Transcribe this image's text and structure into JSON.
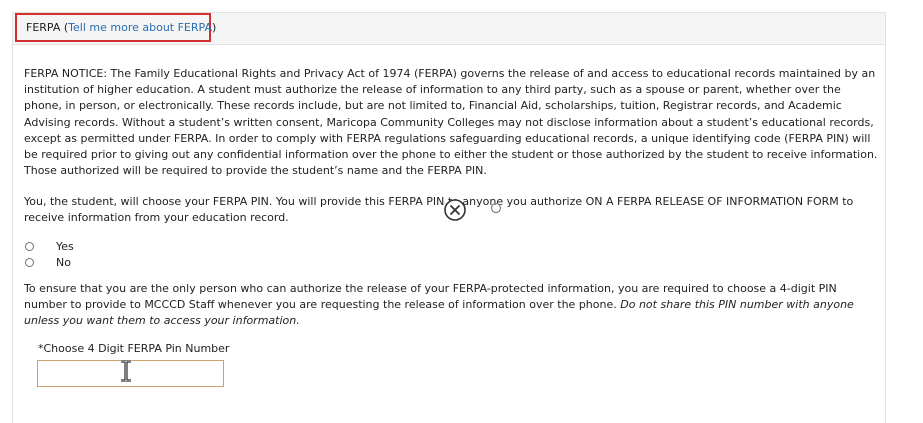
{
  "header": {
    "title_prefix": "FERPA (",
    "link": "Tell me more about FERPA",
    "title_suffix": ")"
  },
  "notice": "FERPA NOTICE: The Family Educational Rights and Privacy Act of 1974 (FERPA) governs the release of and access to educational records maintained by an institution of higher education. A student must authorize the release of information to any third party, such as a spouse or parent, whether over the phone, in person, or electronically. These records include, but are not limited to, Financial Aid, scholarships, tuition, Registrar records, and Academic Advising records. Without a student’s written consent, Maricopa Community Colleges may not disclose information about a student’s educational records, except as permitted under FERPA. In order to comply with FERPA regulations safeguarding educational records, a unique identifying code (FERPA PIN) will be required prior to giving out any confidential information over the phone to either the student or those authorized by the student to receive information. Those authorized will be required to provide the student’s name and the FERPA PIN.",
  "choose_text": "You, the student, will choose your FERPA PIN. You will provide this FERPA PIN to anyone you authorize ON A FERPA RELEASE OF INFORMATION FORM to receive information from your education record.",
  "radio_options": [
    "Yes",
    "No"
  ],
  "info_text": "To ensure that you are the only person who can authorize the release of your FERPA-protected information, you are required to choose a 4-digit PIN number to provide to MCCCD Staff whenever you are requesting the release of information over the phone.",
  "info_italic": "Do not share this PIN number with anyone unless you want them to access your information.",
  "pin": {
    "label": "*Choose 4 Digit FERPA Pin Number",
    "value": ""
  },
  "icons": {
    "overlay_close": "close-circle-icon",
    "overlay_small": "small-circle-icon",
    "text_cursor": "i-beam-cursor-icon"
  },
  "colors": {
    "link": "#2a6db0",
    "highlight_border": "#d32f2f",
    "input_border": "#c9a26e"
  }
}
